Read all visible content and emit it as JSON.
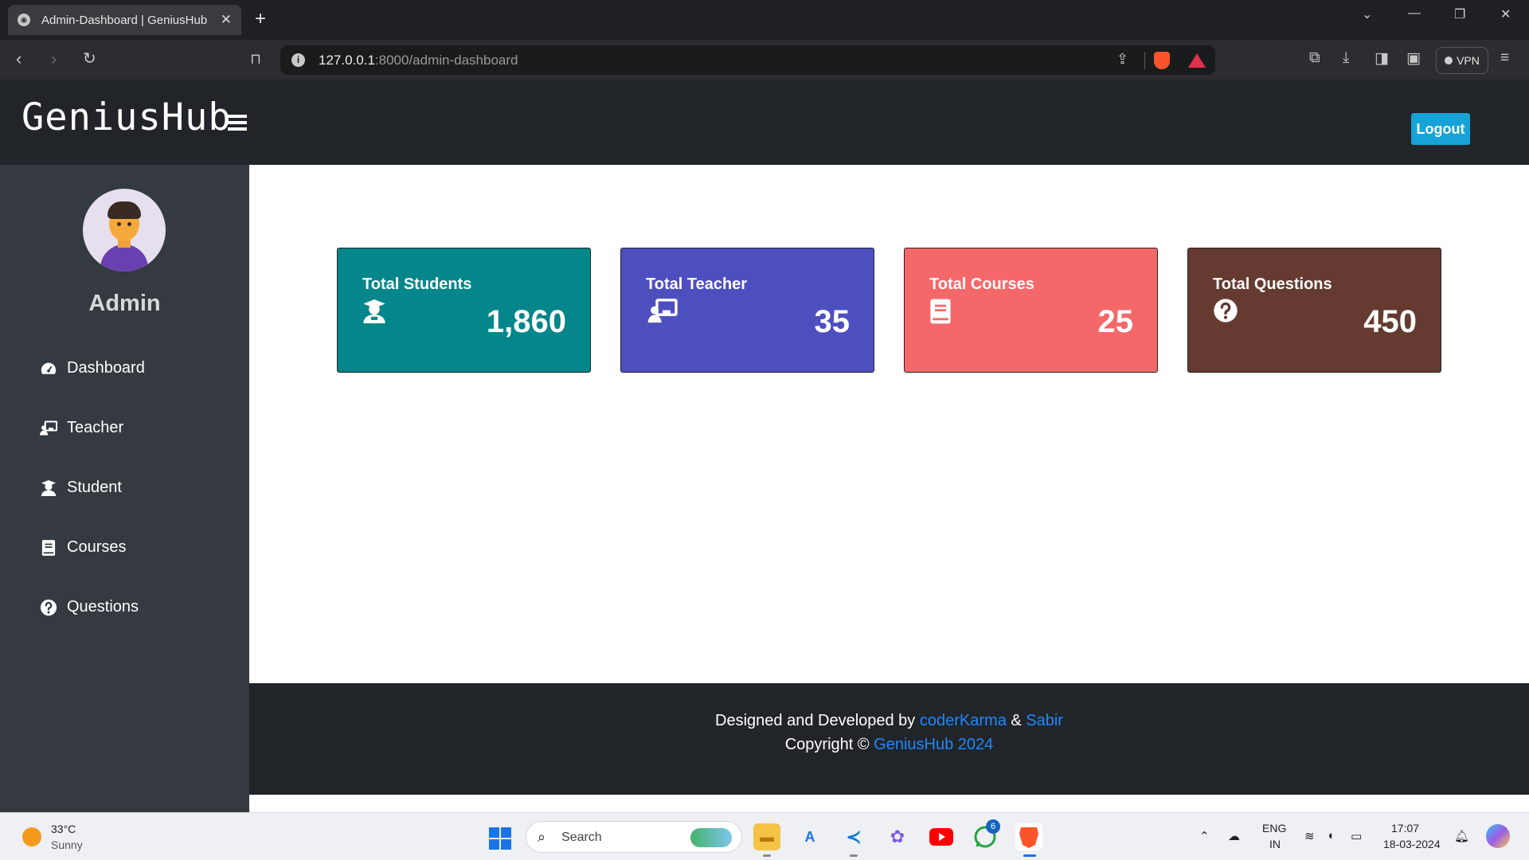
{
  "browser": {
    "tab_title": "Admin-Dashboard | GeniusHub",
    "url_host": "127.0.0.1",
    "url_rest": ":8000/admin-dashboard",
    "vpn_label": "VPN"
  },
  "header": {
    "brand": "GeniusHub",
    "logout_label": "Logout",
    "logout_color": "#17a2d8"
  },
  "sidebar": {
    "user_name": "Admin",
    "items": [
      {
        "label": "Dashboard",
        "icon": "tachometer-icon"
      },
      {
        "label": "Teacher",
        "icon": "chalkboard-teacher-icon"
      },
      {
        "label": "Student",
        "icon": "user-graduate-icon"
      },
      {
        "label": "Courses",
        "icon": "book-icon"
      },
      {
        "label": "Questions",
        "icon": "question-circle-icon"
      }
    ]
  },
  "cards": [
    {
      "label": "Total Students",
      "value": "1,860",
      "color": "#04868b",
      "icon": "user-graduate-icon"
    },
    {
      "label": "Total Teacher",
      "value": "35",
      "color": "#4e4fbf",
      "icon": "chalkboard-teacher-icon"
    },
    {
      "label": "Total Courses",
      "value": "25",
      "color": "#f5686a",
      "icon": "book-icon"
    },
    {
      "label": "Total Questions",
      "value": "450",
      "color": "#653a30",
      "icon": "question-circle-icon"
    }
  ],
  "footer": {
    "designed_text": "Designed and Developed by ",
    "dev1": "coderKarma",
    "amp": " & ",
    "dev2": "Sabir",
    "copyright_text": "Copyright © ",
    "copyright_link": "GeniusHub 2024"
  },
  "taskbar": {
    "temperature": "33°C",
    "condition": "Sunny",
    "search_placeholder": "Search",
    "whatsapp_badge": "6",
    "lang_line1": "ENG",
    "lang_line2": "IN",
    "time": "17:07",
    "date": "18-03-2024"
  }
}
